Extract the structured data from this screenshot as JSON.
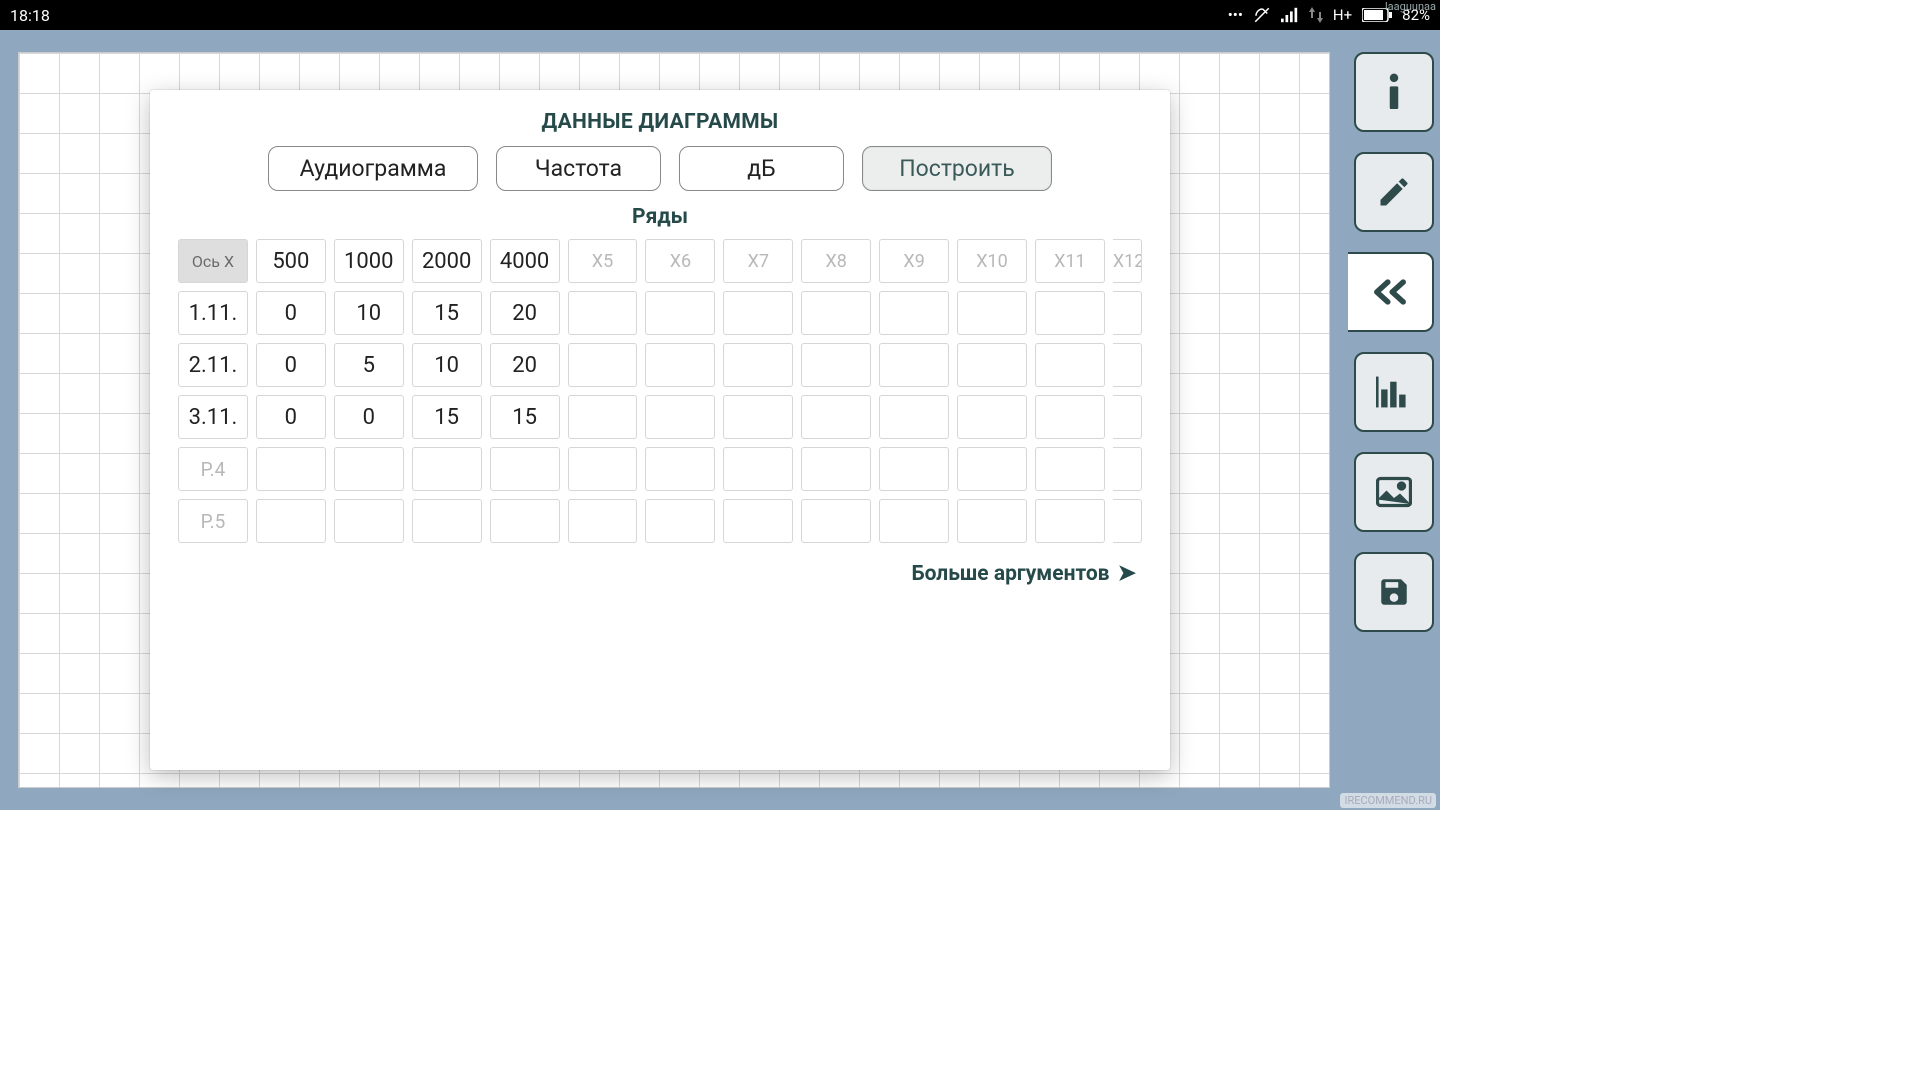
{
  "status": {
    "time": "18:18",
    "network": "H+",
    "battery": "82%",
    "username_watermark": "laaguunaa",
    "site_watermark": "IRECOMMEND.RU"
  },
  "sidebar": {
    "items": [
      {
        "name": "info-icon"
      },
      {
        "name": "pencil-icon"
      },
      {
        "name": "collapse-icon"
      },
      {
        "name": "chart-icon"
      },
      {
        "name": "image-icon"
      },
      {
        "name": "save-icon"
      }
    ],
    "active_index": 2
  },
  "card": {
    "title": "ДАННЫЕ ДИАГРАММЫ",
    "buttons": {
      "name": "Аудиограмма",
      "x_axis": "Частота",
      "y_axis": "дБ",
      "build": "Построить"
    },
    "rows_label": "Ряды",
    "more_args": "Больше аргументов",
    "x_header": "Ось X",
    "x_values": [
      "500",
      "1000",
      "2000",
      "4000"
    ],
    "x_placeholders": [
      "X5",
      "X6",
      "X7",
      "X8",
      "X9",
      "X10",
      "X11",
      "X12"
    ],
    "rows": [
      {
        "label": "1.11.",
        "values": [
          "0",
          "10",
          "15",
          "20"
        ]
      },
      {
        "label": "2.11.",
        "values": [
          "0",
          "5",
          "10",
          "20"
        ]
      },
      {
        "label": "3.11.",
        "values": [
          "0",
          "0",
          "15",
          "15"
        ]
      }
    ],
    "row_placeholders": [
      "Р.4",
      "Р.5"
    ]
  }
}
